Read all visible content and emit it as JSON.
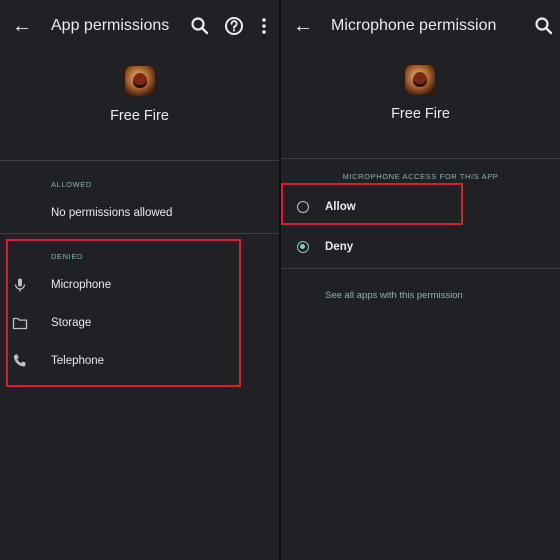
{
  "left": {
    "header": {
      "back_label": "←",
      "title": "App permissions"
    },
    "app": {
      "name": "Free Fire"
    },
    "allowed": {
      "heading": "ALLOWED",
      "empty_text": "No permissions allowed"
    },
    "denied": {
      "heading": "DENIED",
      "items": [
        {
          "label": "Microphone",
          "icon": "microphone-icon"
        },
        {
          "label": "Storage",
          "icon": "folder-icon"
        },
        {
          "label": "Telephone",
          "icon": "phone-icon"
        }
      ]
    }
  },
  "right": {
    "header": {
      "back_label": "←",
      "title": "Microphone permission"
    },
    "app": {
      "name": "Free Fire"
    },
    "section_heading": "MICROPHONE ACCESS FOR THIS APP",
    "options": [
      {
        "label": "Allow",
        "selected": false
      },
      {
        "label": "Deny",
        "selected": true
      }
    ],
    "link": "See all apps with this permission"
  },
  "colors": {
    "background": "#202124",
    "accent": "#80cbc4",
    "highlight": "#d81f2a"
  }
}
